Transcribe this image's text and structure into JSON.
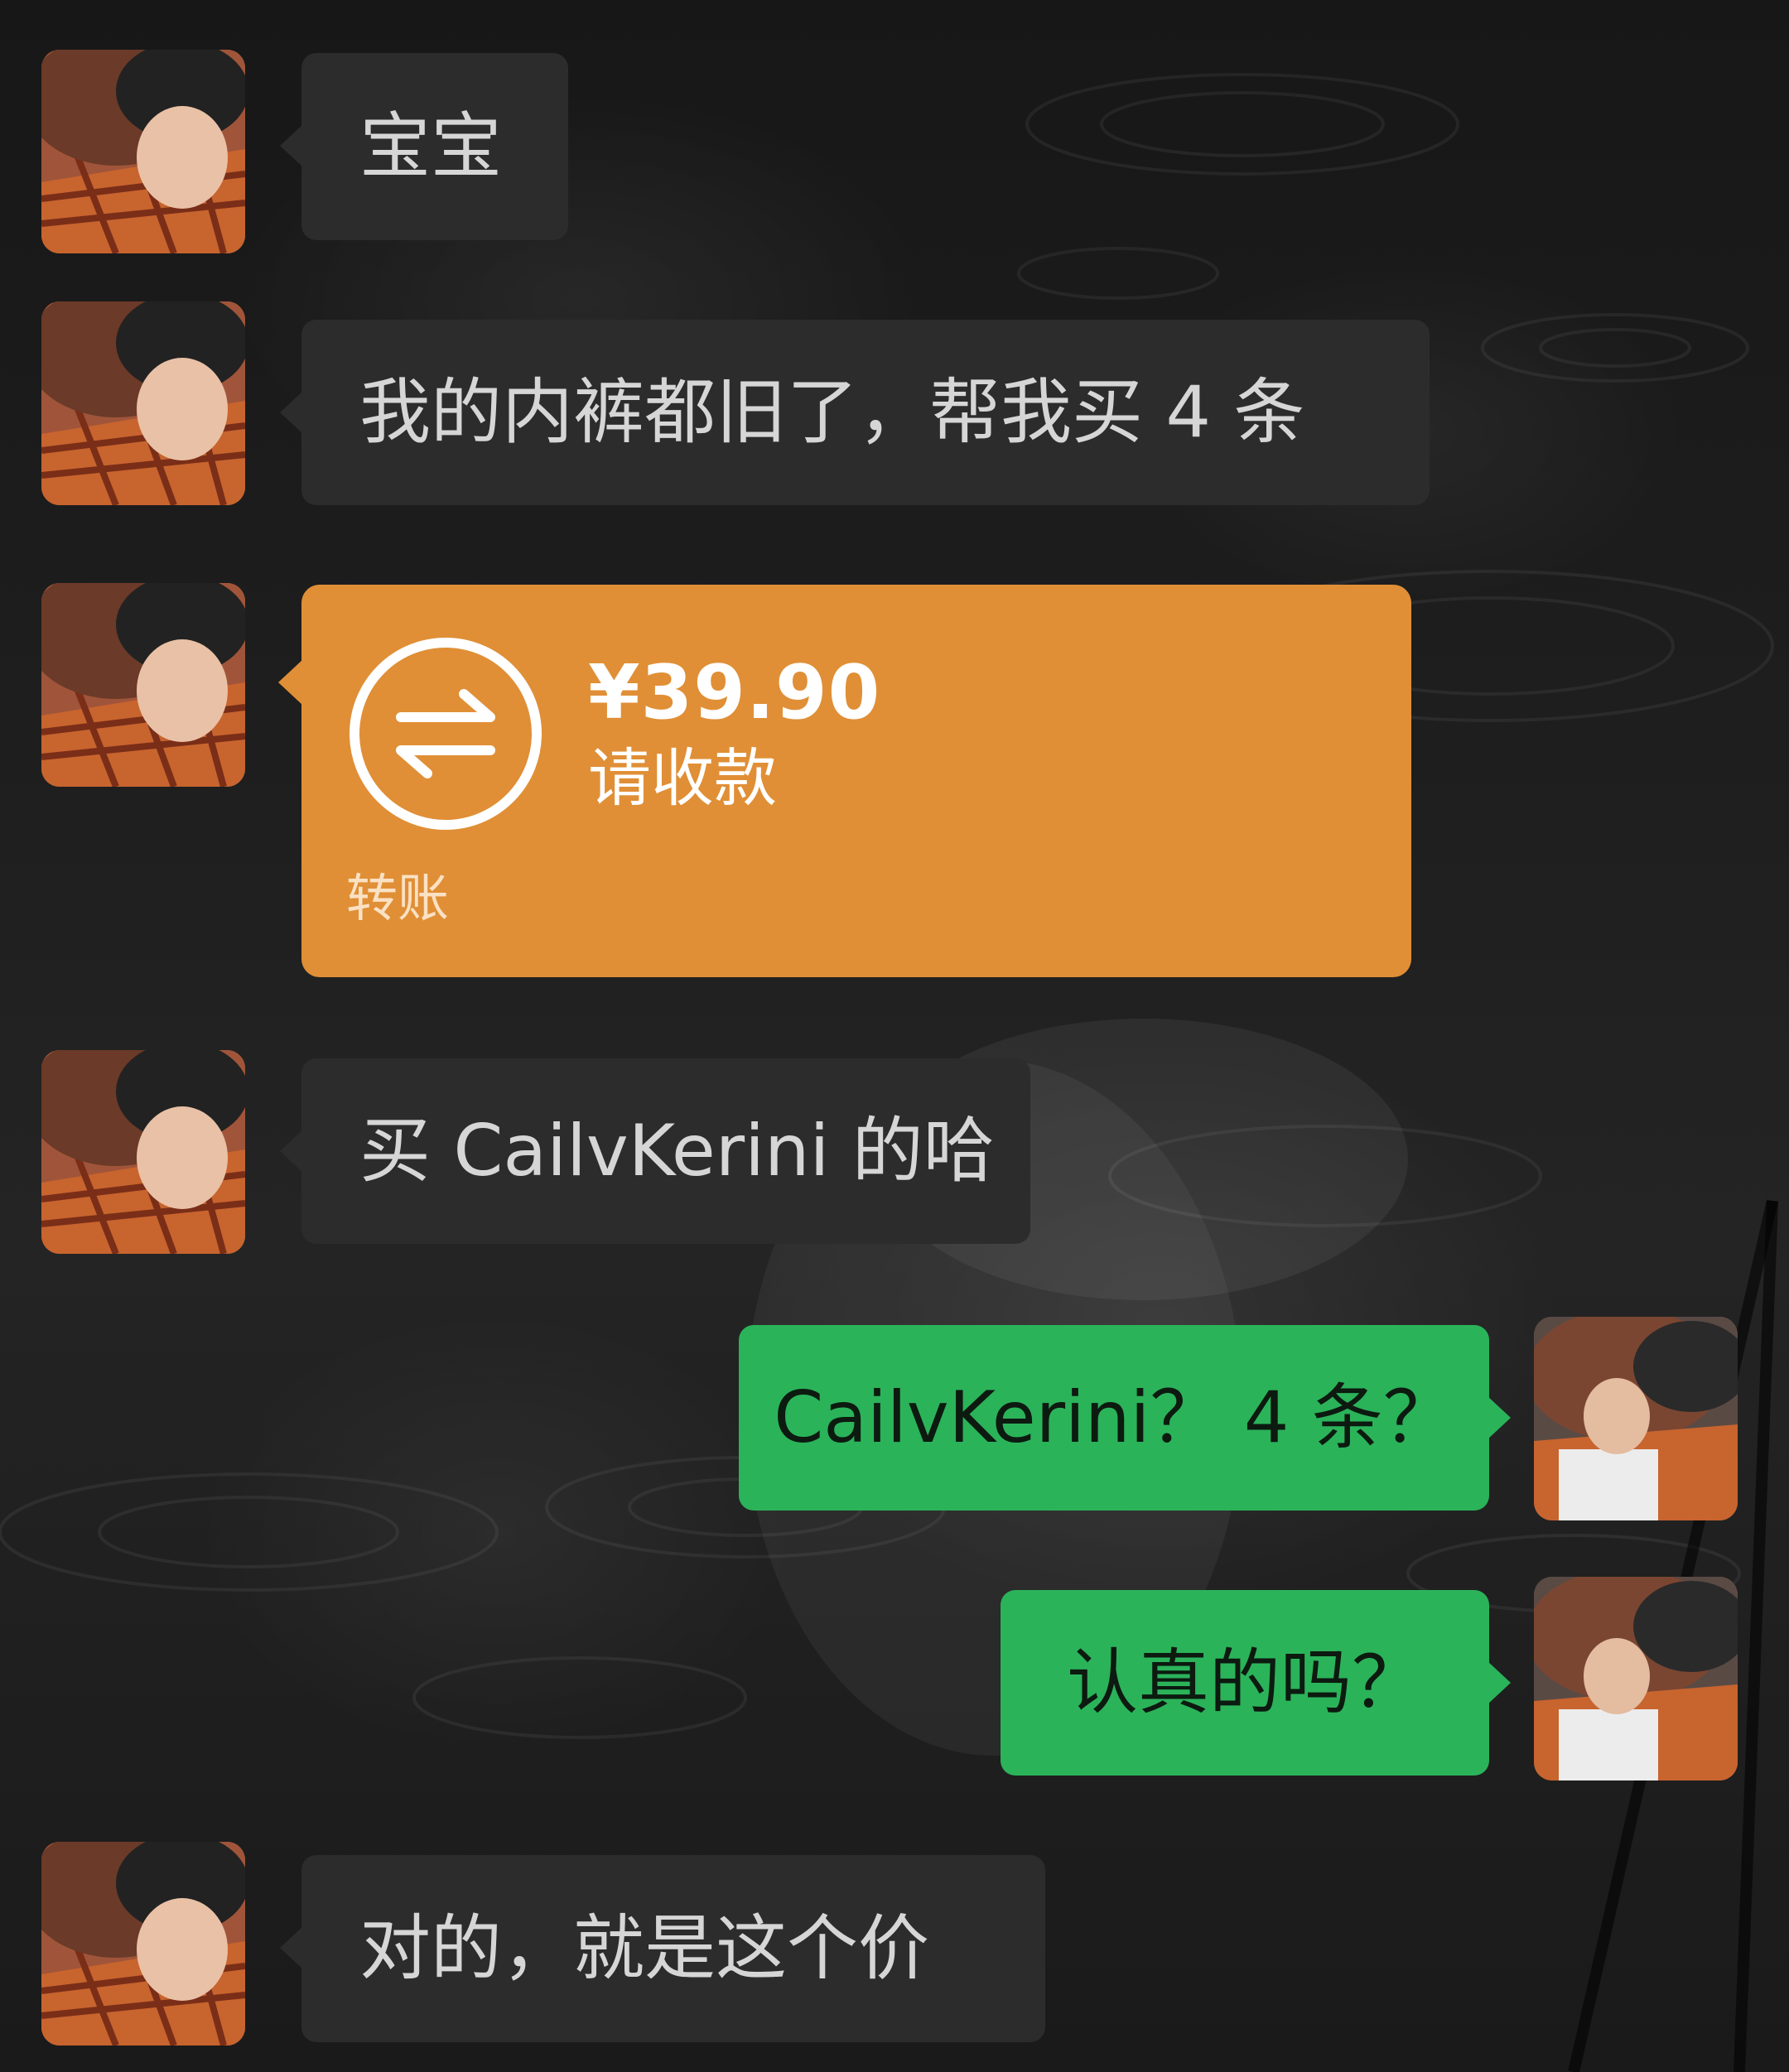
{
  "colors": {
    "incoming_bubble": "#2c2c2c",
    "outgoing_bubble": "#2bb35a",
    "transfer_card": "#e08f36"
  },
  "messages": [
    {
      "sender": "friend",
      "type": "text",
      "text": "宝宝"
    },
    {
      "sender": "friend",
      "type": "text",
      "text": "我的内裤都旧了，帮我买 4 条"
    },
    {
      "sender": "friend",
      "type": "transfer",
      "amount": "¥39.90",
      "status": "请收款",
      "label": "转账",
      "icon": "transfer-arrows-icon"
    },
    {
      "sender": "friend",
      "type": "text",
      "text": "买 CailvKerini 的哈"
    },
    {
      "sender": "me",
      "type": "text",
      "text": "CailvKerini？ 4 条？"
    },
    {
      "sender": "me",
      "type": "text",
      "text": "认真的吗？"
    },
    {
      "sender": "friend",
      "type": "text",
      "text": "对的，就是这个价"
    }
  ]
}
